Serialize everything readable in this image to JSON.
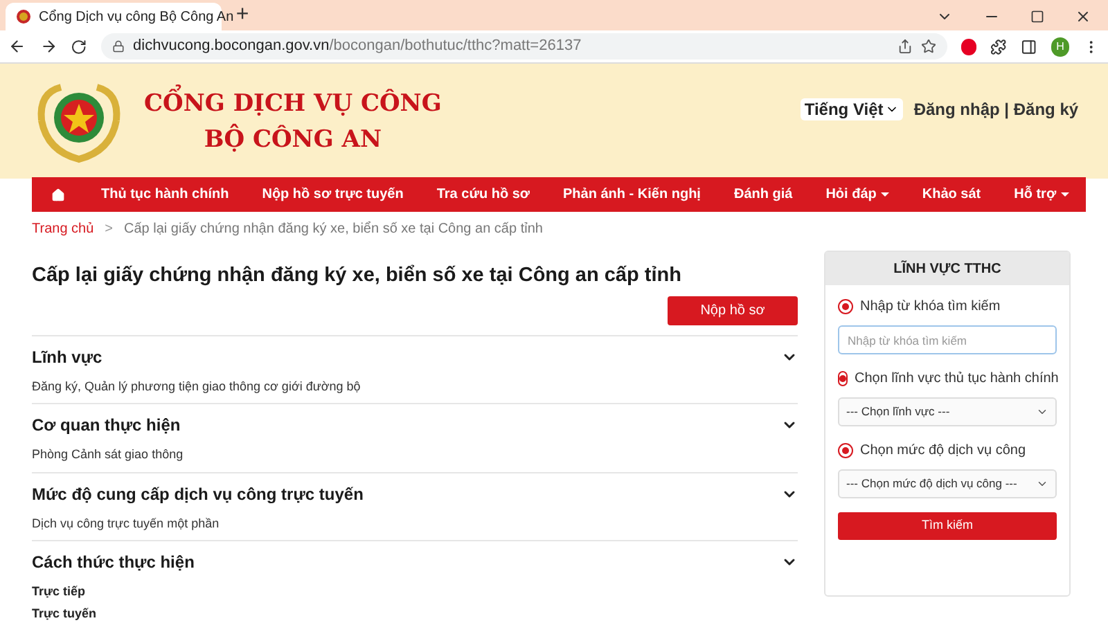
{
  "browser": {
    "tab_title": "Cổng Dịch vụ công Bộ Công An",
    "new_tab": "+",
    "url_host": "dichvucong.bocongan.gov.vn",
    "url_path": "/bocongan/bothutuc/tthc?matt=26137",
    "profile_initial": "H"
  },
  "header": {
    "title_line_1": "CỔNG DỊCH VỤ CÔNG",
    "title_line_2": "BỘ CÔNG AN",
    "language": "Tiếng Việt",
    "login": "Đăng nhập",
    "separator": "|",
    "register": "Đăng ký"
  },
  "nav": [
    {
      "label": "Thủ tục hành chính",
      "dropdown": false
    },
    {
      "label": "Nộp hồ sơ trực tuyến",
      "dropdown": false
    },
    {
      "label": "Tra cứu hồ sơ",
      "dropdown": false
    },
    {
      "label": "Phản ánh - Kiến nghị",
      "dropdown": false
    },
    {
      "label": "Đánh giá",
      "dropdown": false
    },
    {
      "label": "Hỏi đáp",
      "dropdown": true
    },
    {
      "label": "Khảo sát",
      "dropdown": false
    },
    {
      "label": "Hỗ trợ",
      "dropdown": true
    }
  ],
  "breadcrumb": {
    "home": "Trang chủ",
    "separator": ">",
    "current": "Cấp lại giấy chứng nhận đăng ký xe, biển số xe tại Công an cấp tỉnh"
  },
  "page_title": "Cấp lại giấy chứng nhận đăng ký xe, biển số xe tại Công an cấp tỉnh",
  "submit_button": "Nộp hồ sơ",
  "sections": [
    {
      "heading": "Lĩnh vực",
      "lines": [
        "Đăng ký, Quản lý phương tiện giao thông cơ giới đường bộ"
      ],
      "bold_lines": false
    },
    {
      "heading": "Cơ quan thực hiện",
      "lines": [
        "Phòng Cảnh sát giao thông"
      ],
      "bold_lines": false
    },
    {
      "heading": "Mức độ cung cấp dịch vụ công trực tuyến",
      "lines": [
        "Dịch vụ công trực tuyến một phần"
      ],
      "bold_lines": false
    },
    {
      "heading": "Cách thức thực hiện",
      "lines": [
        "Trực tiếp",
        "Trực tuyến"
      ],
      "bold_lines": true
    }
  ],
  "sidebar": {
    "title": "LĨNH VỰC TTHC",
    "options": [
      {
        "kind": "input",
        "label": "Nhập từ khóa tìm kiếm",
        "selected": true,
        "placeholder": "Nhập từ khóa tìm kiếm"
      },
      {
        "kind": "select",
        "label": "Chọn lĩnh vực thủ tục hành chính",
        "selected": true,
        "value": "--- Chọn lĩnh vực ---"
      },
      {
        "kind": "select",
        "label": "Chọn mức độ dịch vụ công",
        "selected": true,
        "value": "--- Chọn mức độ dịch vụ công ---"
      }
    ],
    "search_button": "Tìm kiếm"
  }
}
